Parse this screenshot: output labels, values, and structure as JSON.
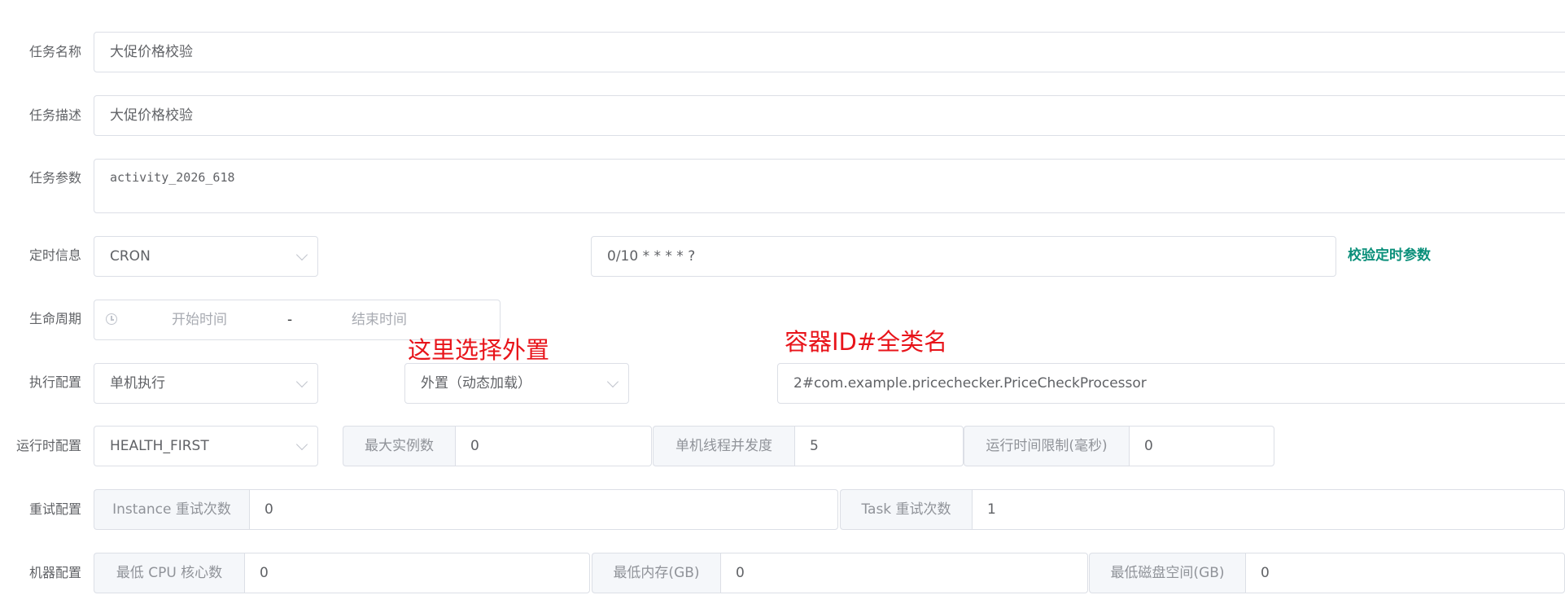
{
  "form": {
    "task_name": {
      "label": "任务名称",
      "value": "大促价格校验"
    },
    "task_desc": {
      "label": "任务描述",
      "value": "大促价格校验"
    },
    "task_params": {
      "label": "任务参数",
      "value": "activity_2026_618"
    },
    "schedule": {
      "label": "定时信息",
      "type_value": "CRON",
      "expression": "0/10 * * * * ?",
      "validate_link": "校验定时参数"
    },
    "lifecycle": {
      "label": "生命周期",
      "start_placeholder": "开始时间",
      "separator": "-",
      "end_placeholder": "结束时间"
    },
    "execution": {
      "label": "执行配置",
      "mode_value": "单机执行",
      "processor_type_value": "外置（动态加载）",
      "processor_info_value": "2#com.example.pricechecker.PriceCheckProcessor"
    },
    "runtime": {
      "label": "运行时配置",
      "dispatch_value": "HEALTH_FIRST",
      "max_instances_label": "最大实例数",
      "max_instances_value": "0",
      "concurrency_label": "单机线程并发度",
      "concurrency_value": "5",
      "time_limit_label": "运行时间限制(毫秒)",
      "time_limit_value": "0"
    },
    "retry": {
      "label": "重试配置",
      "instance_retry_label": "Instance 重试次数",
      "instance_retry_value": "0",
      "task_retry_label": "Task 重试次数",
      "task_retry_value": "1"
    },
    "machine": {
      "label": "机器配置",
      "min_cpu_label": "最低 CPU 核心数",
      "min_cpu_value": "0",
      "min_memory_label": "最低内存(GB)",
      "min_memory_value": "0",
      "min_disk_label": "最低磁盘空间(GB)",
      "min_disk_value": "0"
    }
  },
  "annotations": {
    "external_note": "这里选择外置",
    "container_note": "容器ID#全类名"
  },
  "colors": {
    "annotation": "#e8141a",
    "link": "#0a8f7a",
    "border": "#dcdfe6",
    "prepend_bg": "#f5f7fa"
  }
}
